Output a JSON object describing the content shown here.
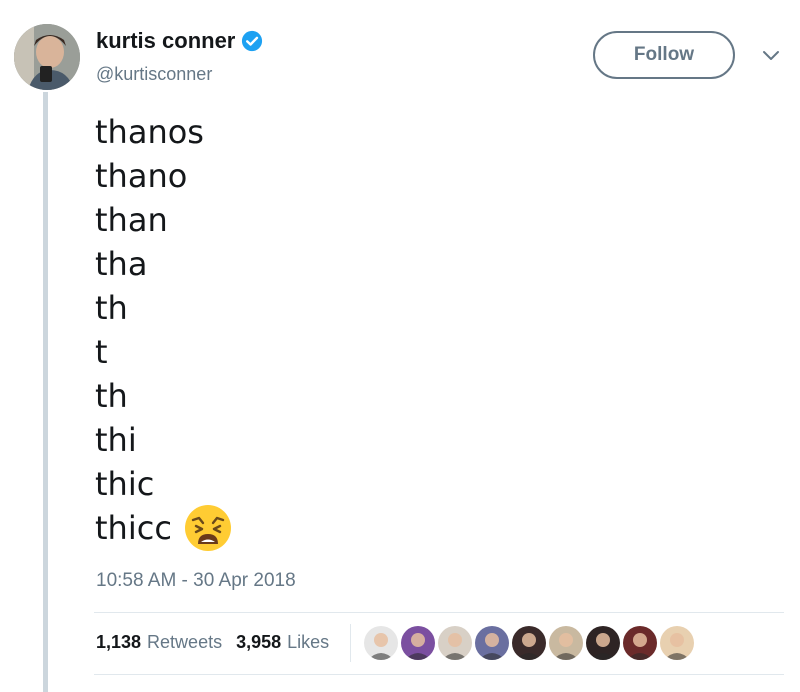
{
  "user": {
    "display_name": "kurtis conner",
    "handle": "@kurtisconner",
    "verified": true
  },
  "follow_button": {
    "label": "Follow"
  },
  "tweet": {
    "lines": [
      "thanos",
      "thano",
      "than",
      "tha",
      "th",
      "t",
      "th",
      "thi",
      "thic",
      "thicc"
    ],
    "emoji": "weary-face-emoji",
    "timestamp": "10:58 AM - 30 Apr 2018"
  },
  "stats": {
    "retweets_count": "1,138",
    "retweets_label": "Retweets",
    "likes_count": "3,958",
    "likes_label": "Likes"
  },
  "likers": [
    {
      "name": "liker-avatar-1",
      "color": "#e6e6e6"
    },
    {
      "name": "liker-avatar-2",
      "color": "#7b4fa0"
    },
    {
      "name": "liker-avatar-3",
      "color": "#d8d0c6"
    },
    {
      "name": "liker-avatar-4",
      "color": "#6a6fa0"
    },
    {
      "name": "liker-avatar-5",
      "color": "#3a2a2a"
    },
    {
      "name": "liker-avatar-6",
      "color": "#c9b9a0"
    },
    {
      "name": "liker-avatar-7",
      "color": "#2e2424"
    },
    {
      "name": "liker-avatar-8",
      "color": "#6b2a2a"
    },
    {
      "name": "liker-avatar-9",
      "color": "#e8d0b0"
    }
  ],
  "colors": {
    "text_primary": "#14171a",
    "text_secondary": "#657786",
    "verified_blue": "#1da1f2",
    "border": "#e1e8ed",
    "thread_line": "#ccd6dd"
  }
}
